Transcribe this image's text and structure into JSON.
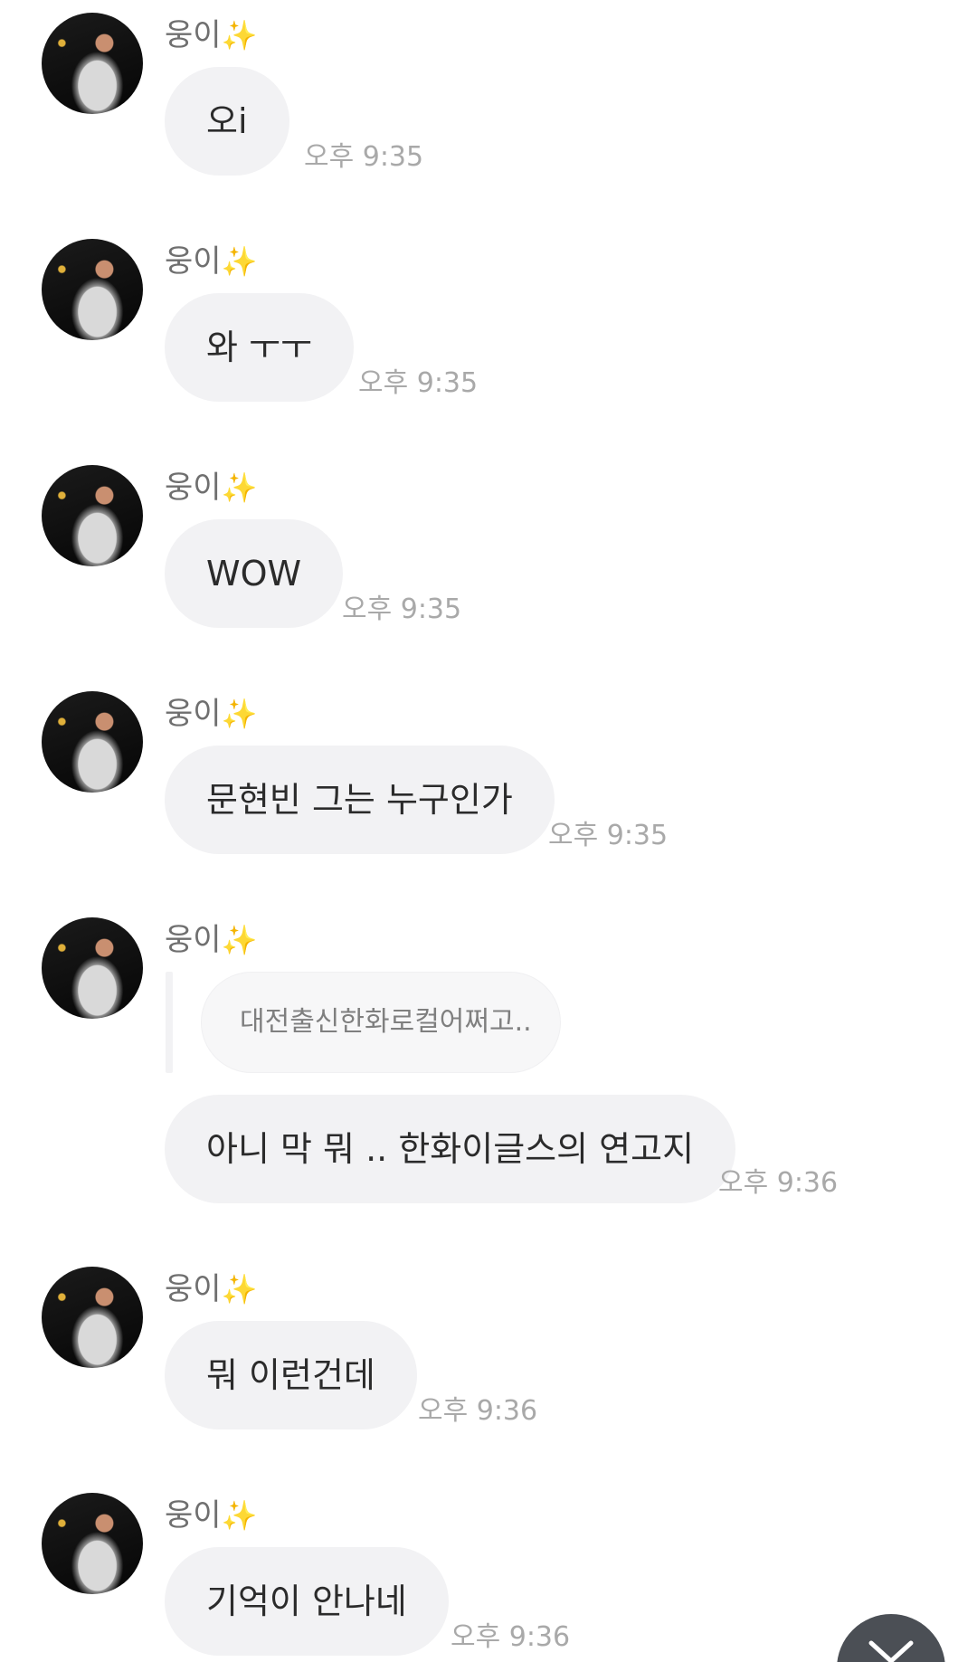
{
  "messages": [
    {
      "sender": "웅이",
      "sender_emoji": "✨",
      "text": "오i",
      "time": "오후 9:35"
    },
    {
      "sender": "웅이",
      "sender_emoji": "✨",
      "text": "와 ㅜㅜ",
      "time": "오후 9:35"
    },
    {
      "sender": "웅이",
      "sender_emoji": "✨",
      "text": "WOW",
      "time": "오후 9:35"
    },
    {
      "sender": "웅이",
      "sender_emoji": "✨",
      "text": "문현빈 그는 누구인가",
      "time": "오후 9:35"
    },
    {
      "sender": "웅이",
      "sender_emoji": "✨",
      "reply_quote": "대전출신한화로컬어쩌고..",
      "text": "아니 막 뭐 .. 한화이글스의 연고지",
      "time": "오후 9:36"
    },
    {
      "sender": "웅이",
      "sender_emoji": "✨",
      "text": "뭐 이런건데",
      "time": "오후 9:36"
    },
    {
      "sender": "웅이",
      "sender_emoji": "✨",
      "text": "기억이 안나네",
      "time": "오후 9:36"
    }
  ],
  "icons": {
    "scroll_down": "chevron-down-icon"
  },
  "colors": {
    "bubble_bg": "#f2f2f4",
    "scroll_button": "#4b4f55"
  }
}
